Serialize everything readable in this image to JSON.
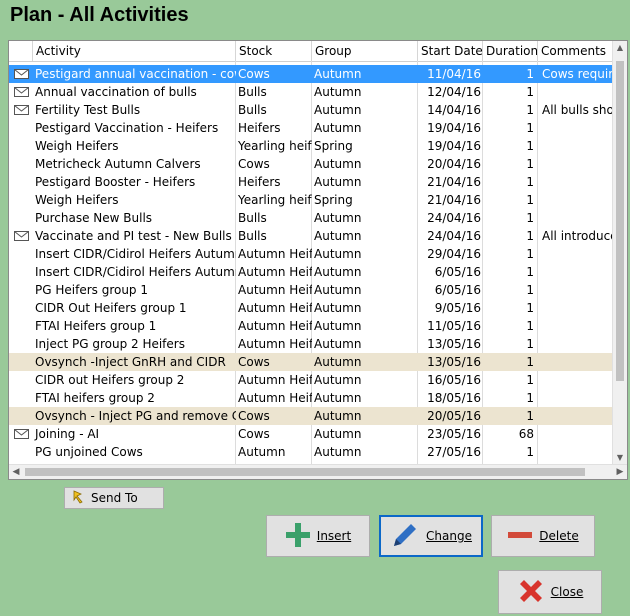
{
  "window_title": "Plan - All Activities",
  "columns": [
    "Activity",
    "Stock",
    "Group",
    "Start Date",
    "Duration",
    "Comments"
  ],
  "rows": [
    {
      "mail": true,
      "activity": "Pestigard annual vaccination - cows",
      "stock": "Cows",
      "group": "Autumn",
      "date": "11/04/16",
      "duration": "1",
      "comments": "Cows require",
      "state": "selected"
    },
    {
      "mail": true,
      "activity": "Annual vaccination of bulls",
      "stock": "Bulls",
      "group": "Autumn",
      "date": "12/04/16",
      "duration": "1",
      "comments": "",
      "state": ""
    },
    {
      "mail": true,
      "activity": "Fertility Test  Bulls",
      "stock": "Bulls",
      "group": "Autumn",
      "date": "14/04/16",
      "duration": "1",
      "comments": "All bulls shou",
      "state": ""
    },
    {
      "mail": false,
      "activity": "Pestigard Vaccination - Heifers",
      "stock": "Heifers",
      "group": "Autumn",
      "date": "19/04/16",
      "duration": "1",
      "comments": "",
      "state": ""
    },
    {
      "mail": false,
      "activity": "Weigh Heifers",
      "stock": "Yearling heife",
      "group": "Spring",
      "date": "19/04/16",
      "duration": "1",
      "comments": "",
      "state": ""
    },
    {
      "mail": false,
      "activity": "Metricheck Autumn Calvers",
      "stock": "Cows",
      "group": "Autumn",
      "date": "20/04/16",
      "duration": "1",
      "comments": "",
      "state": ""
    },
    {
      "mail": false,
      "activity": "Pestigard Booster - Heifers",
      "stock": "Heifers",
      "group": "Autumn",
      "date": "21/04/16",
      "duration": "1",
      "comments": "",
      "state": ""
    },
    {
      "mail": false,
      "activity": "Weigh Heifers",
      "stock": "Yearling heife",
      "group": "Spring",
      "date": "21/04/16",
      "duration": "1",
      "comments": "",
      "state": ""
    },
    {
      "mail": false,
      "activity": "Purchase New Bulls",
      "stock": "Bulls",
      "group": "Autumn",
      "date": "24/04/16",
      "duration": "1",
      "comments": "",
      "state": ""
    },
    {
      "mail": true,
      "activity": "Vaccinate and PI test  - New Bulls",
      "stock": "Bulls",
      "group": "Autumn",
      "date": "24/04/16",
      "duration": "1",
      "comments": "All introduce",
      "state": ""
    },
    {
      "mail": false,
      "activity": "Insert CIDR/Cidirol Heifers Autumn g",
      "stock": "Autumn Heife",
      "group": "Autumn",
      "date": "29/04/16",
      "duration": "1",
      "comments": "",
      "state": ""
    },
    {
      "mail": false,
      "activity": "Insert CIDR/Cidirol Heifers Autumn g",
      "stock": "Autumn Heife",
      "group": "Autumn",
      "date": "6/05/16",
      "duration": "1",
      "comments": "",
      "state": ""
    },
    {
      "mail": false,
      "activity": "PG Heifers group 1",
      "stock": "Autumn Heife",
      "group": "Autumn",
      "date": "6/05/16",
      "duration": "1",
      "comments": "",
      "state": ""
    },
    {
      "mail": false,
      "activity": "CIDR Out Heifers group 1",
      "stock": "Autumn Heife",
      "group": "Autumn",
      "date": "9/05/16",
      "duration": "1",
      "comments": "",
      "state": ""
    },
    {
      "mail": false,
      "activity": "FTAI Heifers group 1",
      "stock": "Autumn Heife",
      "group": "Autumn",
      "date": "11/05/16",
      "duration": "1",
      "comments": "",
      "state": ""
    },
    {
      "mail": false,
      "activity": "Inject PG group 2 Heifers",
      "stock": "Autumn Heife",
      "group": "Autumn",
      "date": "13/05/16",
      "duration": "1",
      "comments": "",
      "state": ""
    },
    {
      "mail": false,
      "activity": "Ovsynch -Inject GnRH and CIDR",
      "stock": "Cows",
      "group": "Autumn",
      "date": "13/05/16",
      "duration": "1",
      "comments": "",
      "state": "tan"
    },
    {
      "mail": false,
      "activity": "CIDR out Heifers group 2",
      "stock": "Autumn Heife",
      "group": "Autumn",
      "date": "16/05/16",
      "duration": "1",
      "comments": "",
      "state": ""
    },
    {
      "mail": false,
      "activity": "FTAI heifers group 2",
      "stock": "Autumn Heife",
      "group": "Autumn",
      "date": "18/05/16",
      "duration": "1",
      "comments": "",
      "state": ""
    },
    {
      "mail": false,
      "activity": "Ovsynch - Inject PG and remove CID",
      "stock": "Cows",
      "group": "Autumn",
      "date": "20/05/16",
      "duration": "1",
      "comments": "",
      "state": "tan"
    },
    {
      "mail": true,
      "activity": "Joining - AI",
      "stock": "Cows",
      "group": "Autumn",
      "date": "23/05/16",
      "duration": "68",
      "comments": "",
      "state": ""
    },
    {
      "mail": false,
      "activity": "PG unjoined Cows",
      "stock": "Autumn",
      "group": "Autumn",
      "date": "27/05/16",
      "duration": "1",
      "comments": "",
      "state": ""
    }
  ],
  "buttons": {
    "send_to": "Send To",
    "insert": "Insert",
    "change": "Change",
    "delete": "Delete",
    "close": "Close"
  },
  "icons": {
    "mail": "envelope-icon",
    "send_to": "send-to-icon",
    "insert": "plus-icon",
    "change": "pencil-icon",
    "delete": "minus-icon",
    "close": "x-icon"
  },
  "colors": {
    "background": "#99c999",
    "selection": "#3399ff",
    "highlight_row": "#ece4d0",
    "insert_icon": "#3aa06a",
    "change_icon": "#2f6fc4",
    "delete_icon": "#d24a3a",
    "close_icon": "#d8342c"
  }
}
